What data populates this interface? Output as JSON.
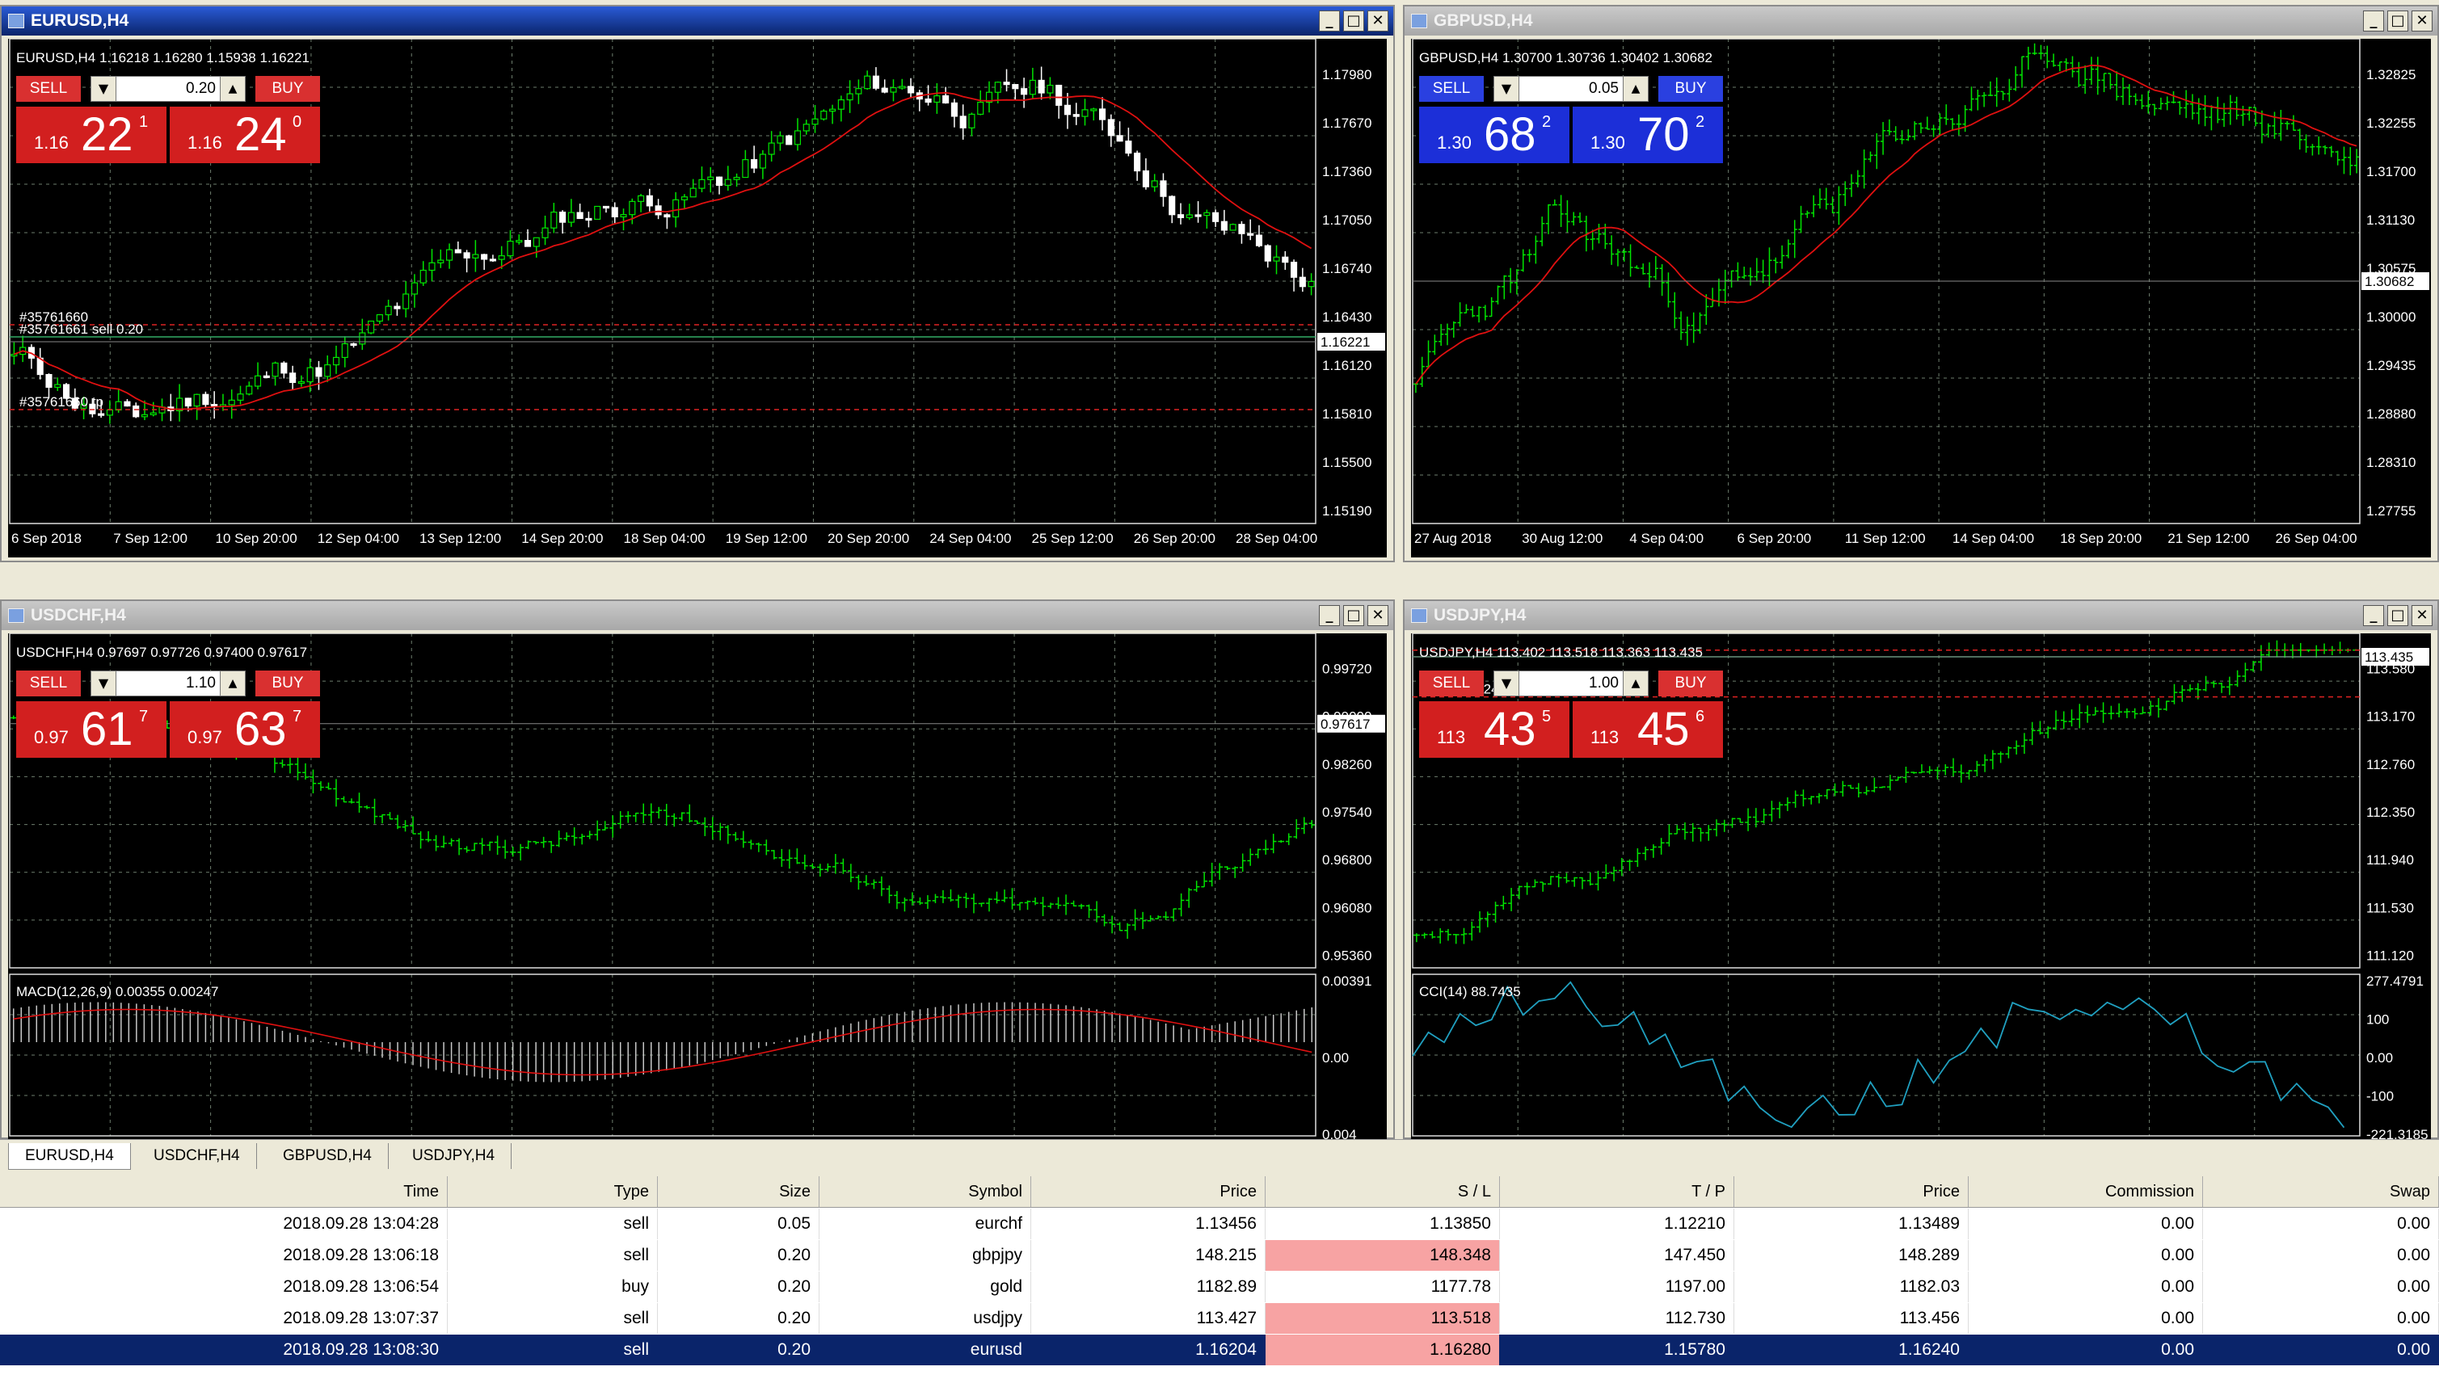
{
  "colors": {
    "bull": "#00e400",
    "bear": "#ffffff",
    "ma": "#e01010",
    "grid": "#6e7e6e",
    "level": "#d22",
    "cci": "#20a0c0",
    "sell_red": "#d21f1f",
    "sell_blue": "#1c2fd8"
  },
  "windows": [
    {
      "title": "EURUSD,H4",
      "active": true,
      "symbol_line": "EURUSD,H4  1.16218 1.16280 1.15938 1.16221",
      "trade": {
        "sell": "SELL",
        "buy": "BUY",
        "volume": "0.20",
        "bid_small": "1.16",
        "bid_big": "22",
        "bid_sup": "1",
        "ask_small": "1.16",
        "ask_big": "24",
        "ask_sup": "0",
        "color": "red"
      },
      "axis_labels": [
        "1.17980",
        "1.17670",
        "1.17360",
        "1.17050",
        "1.16740",
        "1.16430",
        "1.16120",
        "1.15810",
        "1.15500",
        "1.15190"
      ],
      "price_label": "1.16221",
      "time_labels": [
        "6 Sep 2018",
        "7 Sep 12:00",
        "10 Sep 20:00",
        "12 Sep 04:00",
        "13 Sep 12:00",
        "14 Sep 20:00",
        "18 Sep 04:00",
        "19 Sep 12:00",
        "20 Sep 20:00",
        "24 Sep 04:00",
        "25 Sep 12:00",
        "26 Sep 20:00",
        "28 Sep 04:00"
      ],
      "order_labels": [
        "#35761660",
        "#35761661 sell 0.20",
        "#35761660 tp"
      ]
    },
    {
      "title": "GBPUSD,H4",
      "active": false,
      "symbol_line": "GBPUSD,H4  1.30700 1.30736 1.30402 1.30682",
      "trade": {
        "sell": "SELL",
        "buy": "BUY",
        "volume": "0.05",
        "bid_small": "1.30",
        "bid_big": "68",
        "bid_sup": "2",
        "ask_small": "1.30",
        "ask_big": "70",
        "ask_sup": "2",
        "color": "blue"
      },
      "axis_labels": [
        "1.32825",
        "1.32255",
        "1.31700",
        "1.31130",
        "1.30575",
        "1.30000",
        "1.29435",
        "1.28880",
        "1.28310",
        "1.27755"
      ],
      "price_label": "1.30682",
      "time_labels": [
        "27 Aug 2018",
        "30 Aug 12:00",
        "4 Sep 04:00",
        "6 Sep 20:00",
        "11 Sep 12:00",
        "14 Sep 04:00",
        "18 Sep 20:00",
        "21 Sep 12:00",
        "26 Sep 04:00"
      ]
    },
    {
      "title": "USDCHF,H4",
      "active": false,
      "symbol_line": "USDCHF,H4  0.97697 0.97726 0.97400 0.97617",
      "trade": {
        "sell": "SELL",
        "buy": "BUY",
        "volume": "1.10",
        "bid_small": "0.97",
        "bid_big": "61",
        "bid_sup": "7",
        "ask_small": "0.97",
        "ask_big": "63",
        "ask_sup": "7",
        "color": "red"
      },
      "axis_labels": [
        "0.99720",
        "0.99000",
        "0.98260",
        "0.97540",
        "0.96800",
        "0.96080",
        "0.95360"
      ],
      "price_label": "0.97617",
      "indicator": {
        "title": "MACD(12,26,9) 0.00355 0.00247",
        "labels": [
          "0.00391",
          "0.00",
          "0.004"
        ]
      }
    },
    {
      "title": "USDJPY,H4",
      "active": false,
      "symbol_line": "USDJPY,H4  113.402 113.518 113.363 113.435",
      "trade": {
        "sell": "SELL",
        "buy": "BUY",
        "volume": "1.00",
        "bid_small": "113",
        "bid_big": "43",
        "bid_sup": "5",
        "ask_small": "113",
        "ask_big": "45",
        "ask_sup": "6",
        "color": "red"
      },
      "axis_labels": [
        "113.580",
        "113.170",
        "112.760",
        "112.350",
        "111.940",
        "111.530",
        "111.120"
      ],
      "price_label": "113.435",
      "order_labels": [
        "#357616224 tp"
      ],
      "indicator": {
        "title": "CCI(14) 88.7435",
        "labels": [
          "277.4791",
          "100",
          "0.00",
          "-100",
          "-221.3185"
        ]
      }
    }
  ],
  "tabs": [
    "EURUSD,H4",
    "USDCHF,H4",
    "GBPUSD,H4",
    "USDJPY,H4"
  ],
  "table": {
    "columns": [
      "Time",
      "Type",
      "Size",
      "Symbol",
      "Price",
      "S / L",
      "T / P",
      "Price",
      "Commission",
      "Swap"
    ],
    "rows": [
      {
        "cells": [
          "2018.09.28 13:04:28",
          "sell",
          "0.05",
          "eurchf",
          "1.13456",
          "1.13850",
          "1.12210",
          "1.13489",
          "0.00",
          "0.00"
        ],
        "sl_alert": false
      },
      {
        "cells": [
          "2018.09.28 13:06:18",
          "sell",
          "0.20",
          "gbpjpy",
          "148.215",
          "148.348",
          "147.450",
          "148.289",
          "0.00",
          "0.00"
        ],
        "sl_alert": true
      },
      {
        "cells": [
          "2018.09.28 13:06:54",
          "buy",
          "0.20",
          "gold",
          "1182.89",
          "1177.78",
          "1197.00",
          "1182.03",
          "0.00",
          "0.00"
        ],
        "sl_alert": false
      },
      {
        "cells": [
          "2018.09.28 13:07:37",
          "sell",
          "0.20",
          "usdjpy",
          "113.427",
          "113.518",
          "112.730",
          "113.456",
          "0.00",
          "0.00"
        ],
        "sl_alert": true
      },
      {
        "cells": [
          "2018.09.28 13:08:30",
          "sell",
          "0.20",
          "eurusd",
          "1.16204",
          "1.16280",
          "1.15780",
          "1.16240",
          "0.00",
          "0.00"
        ],
        "sl_alert": true,
        "selected": true
      }
    ]
  }
}
